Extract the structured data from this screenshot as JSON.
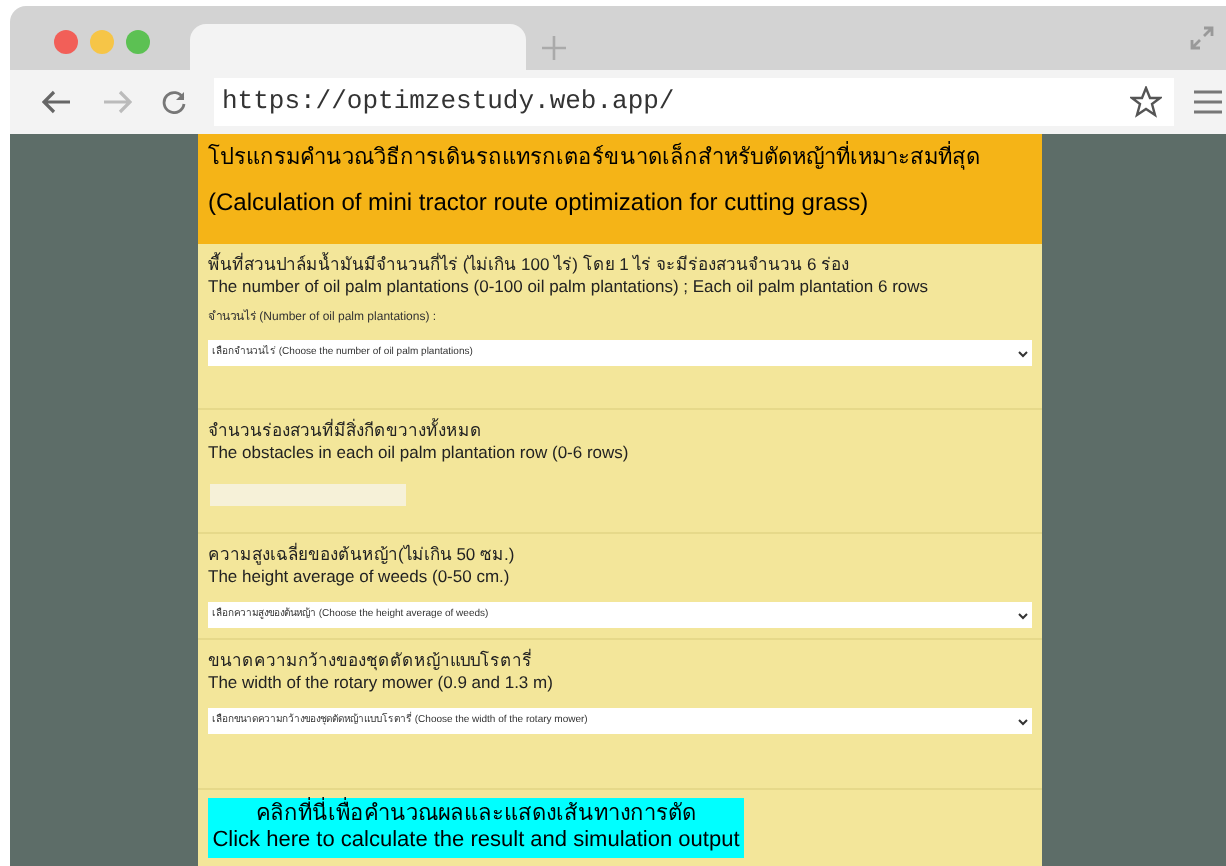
{
  "browser": {
    "url": "https://optimzestudy.web.app/"
  },
  "header": {
    "title_thai": "โปรแกรมคำนวณวิธีการเดินรถแทรกเตอร์ขนาดเล็กสำหรับตัดหญ้าที่เหมาะสมที่สุด",
    "title_english": "(Calculation of mini tractor route optimization for cutting grass)"
  },
  "sections": [
    {
      "kind": "select",
      "heading_thai": "พื้นที่สวนปาล์มน้ำมันมีจำนวนกี่ไร่ (ไม่เกิน 100 ไร่) โดย 1 ไร่ จะมีร่องสวนจำนวน 6 ร่อง",
      "heading_english": "The number of oil palm plantations (0-100 oil palm plantations) ; Each oil palm plantation 6 rows",
      "field_label": "จำนวนไร่ (Number of oil palm plantations) :",
      "value": "เลือกจำนวนไร่ (Choose the number of oil palm plantations)"
    },
    {
      "kind": "input",
      "heading_thai": "จำนวนร่องสวนที่มีสิ่งกีดขวางทั้งหมด",
      "heading_english": "The obstacles in each oil palm plantation row (0-6 rows)"
    },
    {
      "kind": "select",
      "heading_thai": "ความสูงเฉลี่ยของต้นหญ้า(ไม่เกิน 50 ซม.)",
      "heading_english": "The height average of weeds (0-50 cm.)",
      "value": "เลือกความสูงของต้นหญ้า (Choose the height average of weeds)"
    },
    {
      "kind": "select",
      "heading_thai": "ขนาดความกว้างของชุดตัดหญ้าแบบโรตารี่",
      "heading_english": "The width of the rotary mower (0.9 and 1.3 m)",
      "value": "เลือกขนาดความกว้างของชุดตัดหญ้าแบบโรตารี่ (Choose the width of the rotary mower)"
    }
  ],
  "calculate_button": {
    "line_thai": "คลิกที่นี่เพื่อคำนวณผลและแสดงเส้นทางการตัด",
    "line_english": "Click here to calculate the result and simulation output"
  }
}
